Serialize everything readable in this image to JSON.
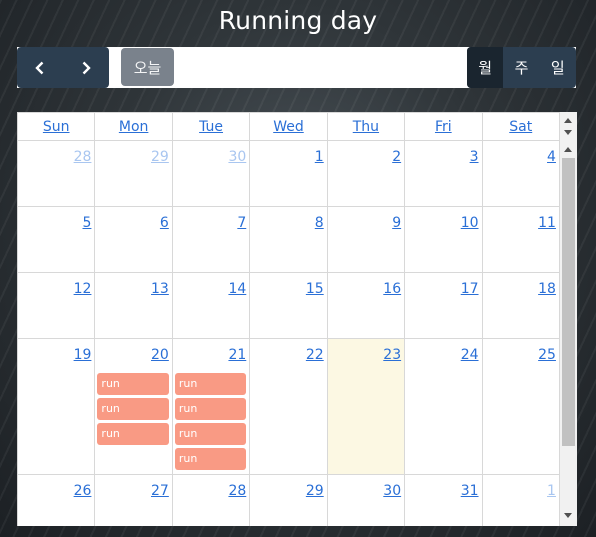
{
  "title": "Running day",
  "toolbar": {
    "prev_icon": "chevron-left-icon",
    "next_icon": "chevron-right-icon",
    "today_label": "오늘",
    "views": [
      {
        "label": "월",
        "active": true
      },
      {
        "label": "주",
        "active": false
      },
      {
        "label": "일",
        "active": false
      }
    ]
  },
  "calendar": {
    "weekdays": [
      "Sun",
      "Mon",
      "Tue",
      "Wed",
      "Thu",
      "Fri",
      "Sat"
    ],
    "weeks": [
      [
        {
          "d": "28",
          "other": true
        },
        {
          "d": "29",
          "other": true
        },
        {
          "d": "30",
          "other": true
        },
        {
          "d": "1"
        },
        {
          "d": "2"
        },
        {
          "d": "3"
        },
        {
          "d": "4"
        }
      ],
      [
        {
          "d": "5"
        },
        {
          "d": "6"
        },
        {
          "d": "7"
        },
        {
          "d": "8"
        },
        {
          "d": "9"
        },
        {
          "d": "10"
        },
        {
          "d": "11"
        }
      ],
      [
        {
          "d": "12"
        },
        {
          "d": "13"
        },
        {
          "d": "14"
        },
        {
          "d": "15"
        },
        {
          "d": "16"
        },
        {
          "d": "17"
        },
        {
          "d": "18"
        }
      ],
      [
        {
          "d": "19"
        },
        {
          "d": "20",
          "events": [
            "run",
            "run",
            "run"
          ]
        },
        {
          "d": "21",
          "events": [
            "run",
            "run",
            "run",
            "run"
          ]
        },
        {
          "d": "22"
        },
        {
          "d": "23",
          "today": true
        },
        {
          "d": "24"
        },
        {
          "d": "25"
        }
      ],
      [
        {
          "d": "26"
        },
        {
          "d": "27"
        },
        {
          "d": "28"
        },
        {
          "d": "29"
        },
        {
          "d": "30"
        },
        {
          "d": "31"
        },
        {
          "d": "1",
          "other": true
        }
      ]
    ]
  },
  "colors": {
    "accent": "#2a6fd6",
    "toolbar_dark": "#2c3e50",
    "today_bg": "#fcf8e3",
    "event_bg": "#f99a84"
  }
}
